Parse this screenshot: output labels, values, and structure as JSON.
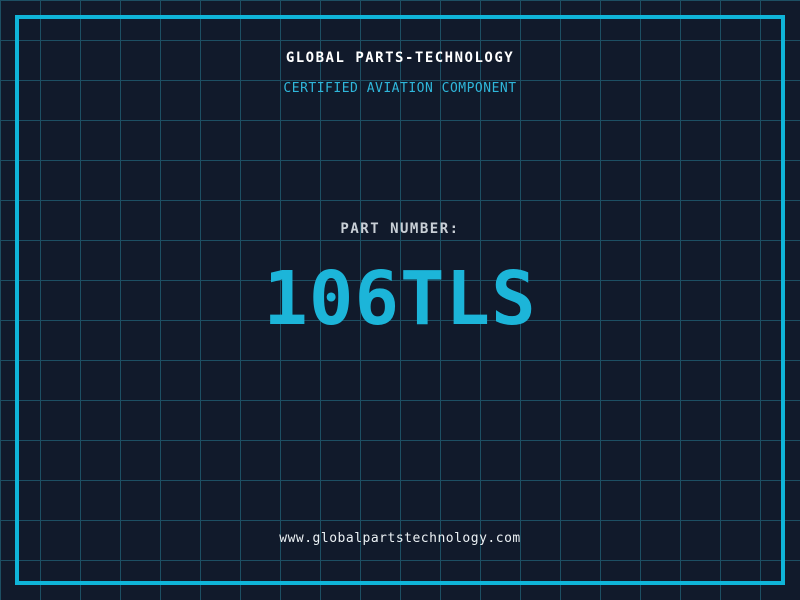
{
  "label": {
    "company_name": "GLOBAL PARTS-TECHNOLOGY",
    "tagline": "CERTIFIED AVIATION COMPONENT",
    "part_label": "PART NUMBER:",
    "part_number": "106TLS",
    "website": "www.globalpartstechnology.com"
  },
  "colors": {
    "background": "#111A2B",
    "grid_line": "#1D4F63",
    "frame_cyan": "#0FB4D8",
    "accent_cyan": "#1CB5D9",
    "title_white": "#FFFFFF",
    "label_gray": "#C9CFD6",
    "url_white": "#ECF1F4"
  }
}
